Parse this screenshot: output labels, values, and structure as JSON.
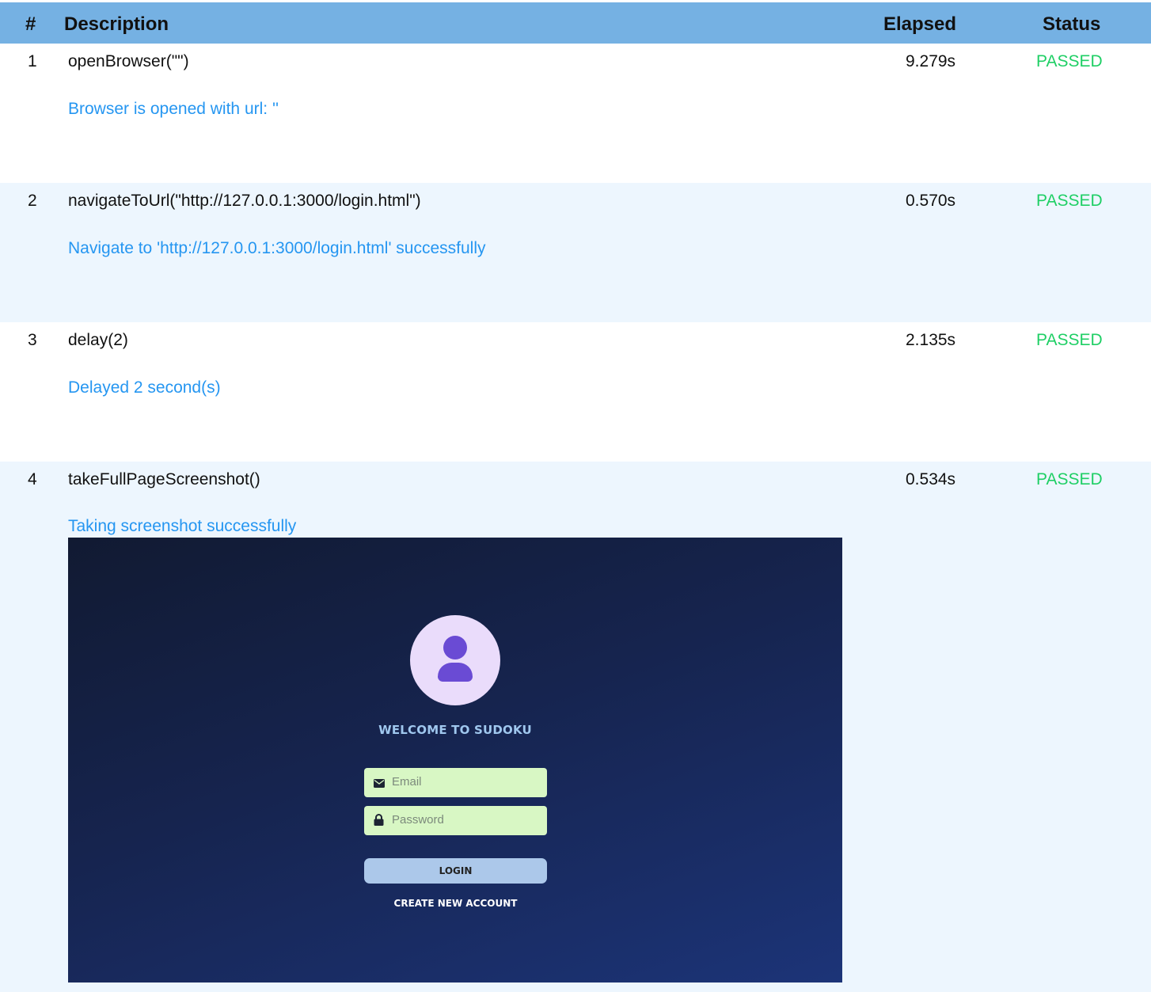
{
  "table": {
    "headers": {
      "num": "#",
      "description": "Description",
      "elapsed": "Elapsed",
      "status": "Status"
    },
    "rows": [
      {
        "num": "1",
        "description": "openBrowser(\"\")",
        "elapsed": "9.279s",
        "status": "PASSED",
        "message": "Browser is opened with url: ''"
      },
      {
        "num": "2",
        "description": "navigateToUrl(\"http://127.0.0.1:3000/login.html\")",
        "elapsed": "0.570s",
        "status": "PASSED",
        "message": "Navigate to 'http://127.0.0.1:3000/login.html' successfully"
      },
      {
        "num": "3",
        "description": "delay(2)",
        "elapsed": "2.135s",
        "status": "PASSED",
        "message": "Delayed 2 second(s)"
      },
      {
        "num": "4",
        "description": "takeFullPageScreenshot()",
        "elapsed": "0.534s",
        "status": "PASSED",
        "message": "Taking screenshot successfully"
      }
    ]
  },
  "screenshot": {
    "welcome_title": "WELCOME TO SUDOKU",
    "email_placeholder": "Email",
    "password_placeholder": "Password",
    "login_label": "LOGIN",
    "create_account_label": "CREATE NEW ACCOUNT",
    "icons": {
      "avatar": "user-icon",
      "email": "envelope-icon",
      "password": "lock-icon"
    }
  },
  "colors": {
    "header_bg": "#75b1e3",
    "row_alt_bg": "#edf6fe",
    "status_passed": "#1fcf65",
    "message": "#2596f1"
  }
}
